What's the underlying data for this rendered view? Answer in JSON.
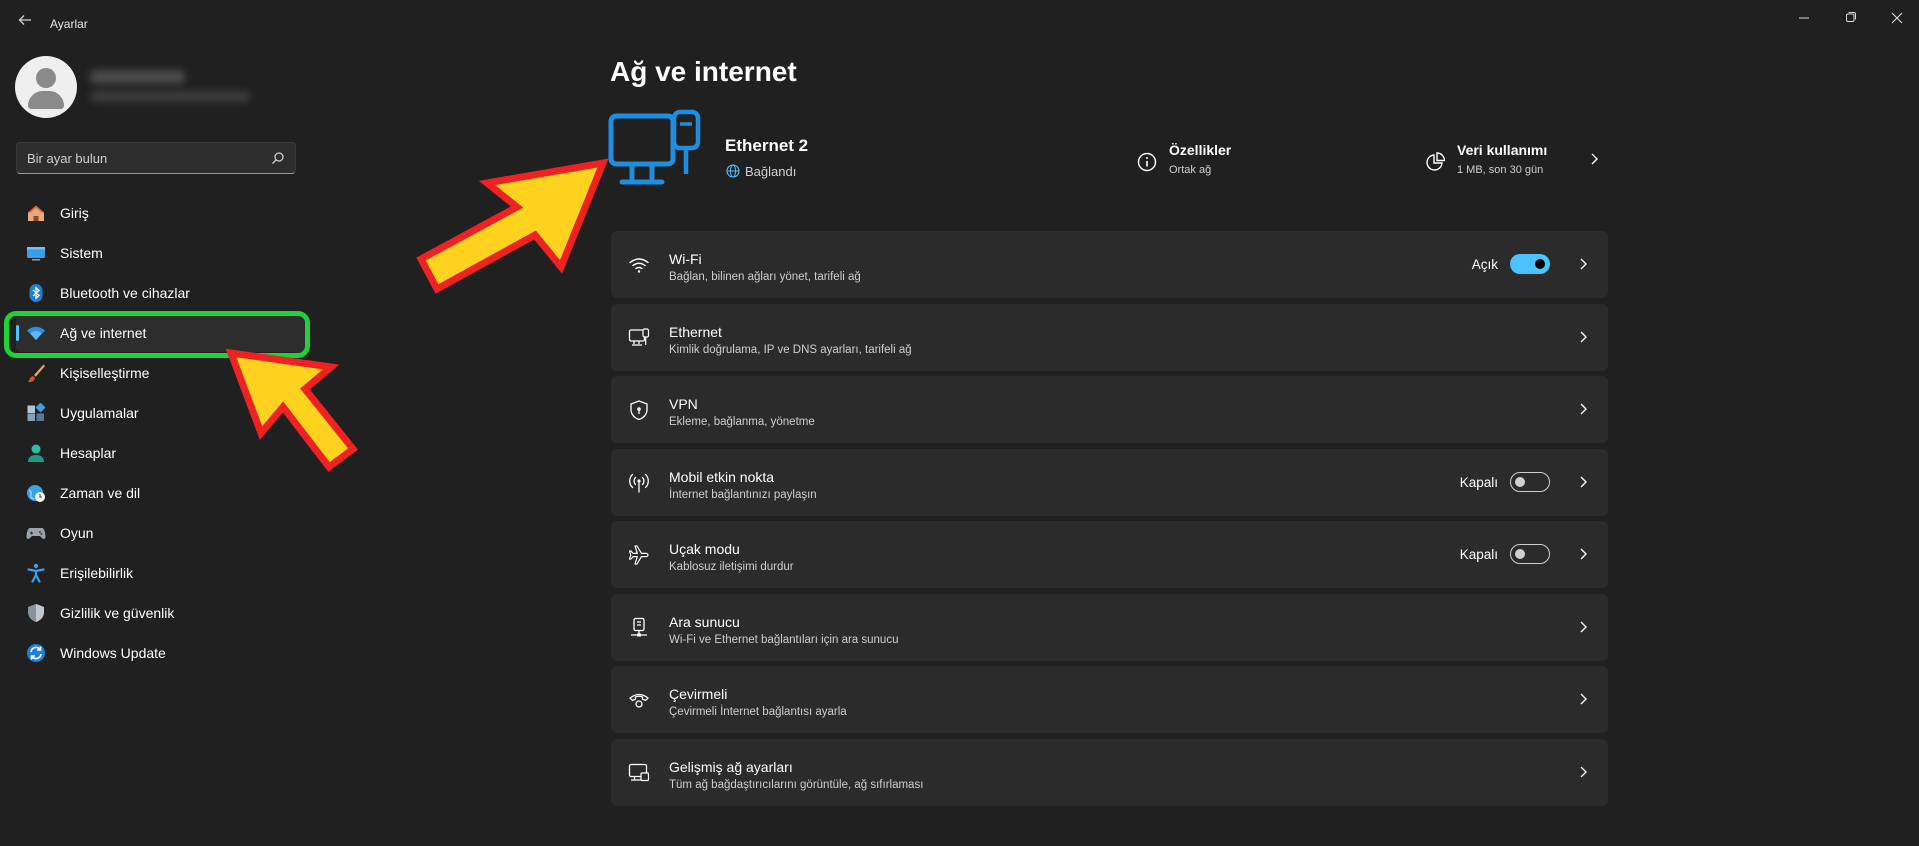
{
  "window": {
    "title": "Ayarlar",
    "back_icon": "arrow-left-icon",
    "controls": [
      "minimize-icon",
      "maximize-icon",
      "close-icon"
    ]
  },
  "search": {
    "placeholder": "Bir ayar bulun",
    "value": ""
  },
  "sidebar": {
    "items": [
      {
        "label": "Giriş",
        "icon": "home-icon",
        "selected": false
      },
      {
        "label": "Sistem",
        "icon": "monitor-icon",
        "selected": false
      },
      {
        "label": "Bluetooth ve cihazlar",
        "icon": "bluetooth-icon",
        "selected": false
      },
      {
        "label": "Ağ ve internet",
        "icon": "wifi-icon",
        "selected": true
      },
      {
        "label": "Kişiselleştirme",
        "icon": "brush-icon",
        "selected": false
      },
      {
        "label": "Uygulamalar",
        "icon": "apps-icon",
        "selected": false
      },
      {
        "label": "Hesaplar",
        "icon": "person-icon",
        "selected": false
      },
      {
        "label": "Zaman ve dil",
        "icon": "globe-clock-icon",
        "selected": false
      },
      {
        "label": "Oyun",
        "icon": "gamepad-icon",
        "selected": false
      },
      {
        "label": "Erişilebilirlik",
        "icon": "accessibility-icon",
        "selected": false
      },
      {
        "label": "Gizlilik ve güvenlik",
        "icon": "shield-icon",
        "selected": false
      },
      {
        "label": "Windows Update",
        "icon": "update-icon",
        "selected": false
      }
    ]
  },
  "main": {
    "title": "Ağ ve internet",
    "connection": {
      "name": "Ethernet 2",
      "status": "Bağlandı",
      "properties": {
        "title": "Özellikler",
        "subtitle": "Ortak ağ"
      },
      "data_usage": {
        "title": "Veri kullanımı",
        "subtitle": "1 MB, son 30 gün"
      }
    },
    "cards": [
      {
        "title": "Wi-Fi",
        "subtitle": "Bağlan, bilinen ağları yönet, tarifeli ağ",
        "icon": "wifi-icon",
        "state": "Açık",
        "toggle": "on"
      },
      {
        "title": "Ethernet",
        "subtitle": "Kimlik doğrulama, IP ve DNS ayarları, tarifeli ağ",
        "icon": "ethernet-icon",
        "state": "",
        "toggle": "none"
      },
      {
        "title": "VPN",
        "subtitle": "Ekleme, bağlanma, yönetme",
        "icon": "vpn-shield-icon",
        "state": "",
        "toggle": "none"
      },
      {
        "title": "Mobil etkin nokta",
        "subtitle": "İnternet bağlantınızı paylaşın",
        "icon": "hotspot-icon",
        "state": "Kapalı",
        "toggle": "off"
      },
      {
        "title": "Uçak modu",
        "subtitle": "Kablosuz iletişimi durdur",
        "icon": "airplane-icon",
        "state": "Kapalı",
        "toggle": "off"
      },
      {
        "title": "Ara sunucu",
        "subtitle": "Wi-Fi ve Ethernet bağlantıları için ara sunucu",
        "icon": "proxy-icon",
        "state": "",
        "toggle": "none"
      },
      {
        "title": "Çevirmeli",
        "subtitle": "Çevirmeli İnternet bağlantısı ayarla",
        "icon": "dialup-icon",
        "state": "",
        "toggle": "none"
      },
      {
        "title": "Gelişmiş ağ ayarları",
        "subtitle": "Tüm ağ bağdaştırıcılarını görüntüle, ağ sıfırlaması",
        "icon": "advanced-network-icon",
        "state": "",
        "toggle": "none"
      }
    ]
  },
  "colors": {
    "background": "#202020",
    "card": "#2b2b2b",
    "accent": "#4cc2ff",
    "hero_icon": "#1e8ee0",
    "annotation_arrow_fill": "#ffd21f",
    "annotation_arrow_stroke": "#ee2222",
    "annotation_box": "#1ed23a"
  }
}
